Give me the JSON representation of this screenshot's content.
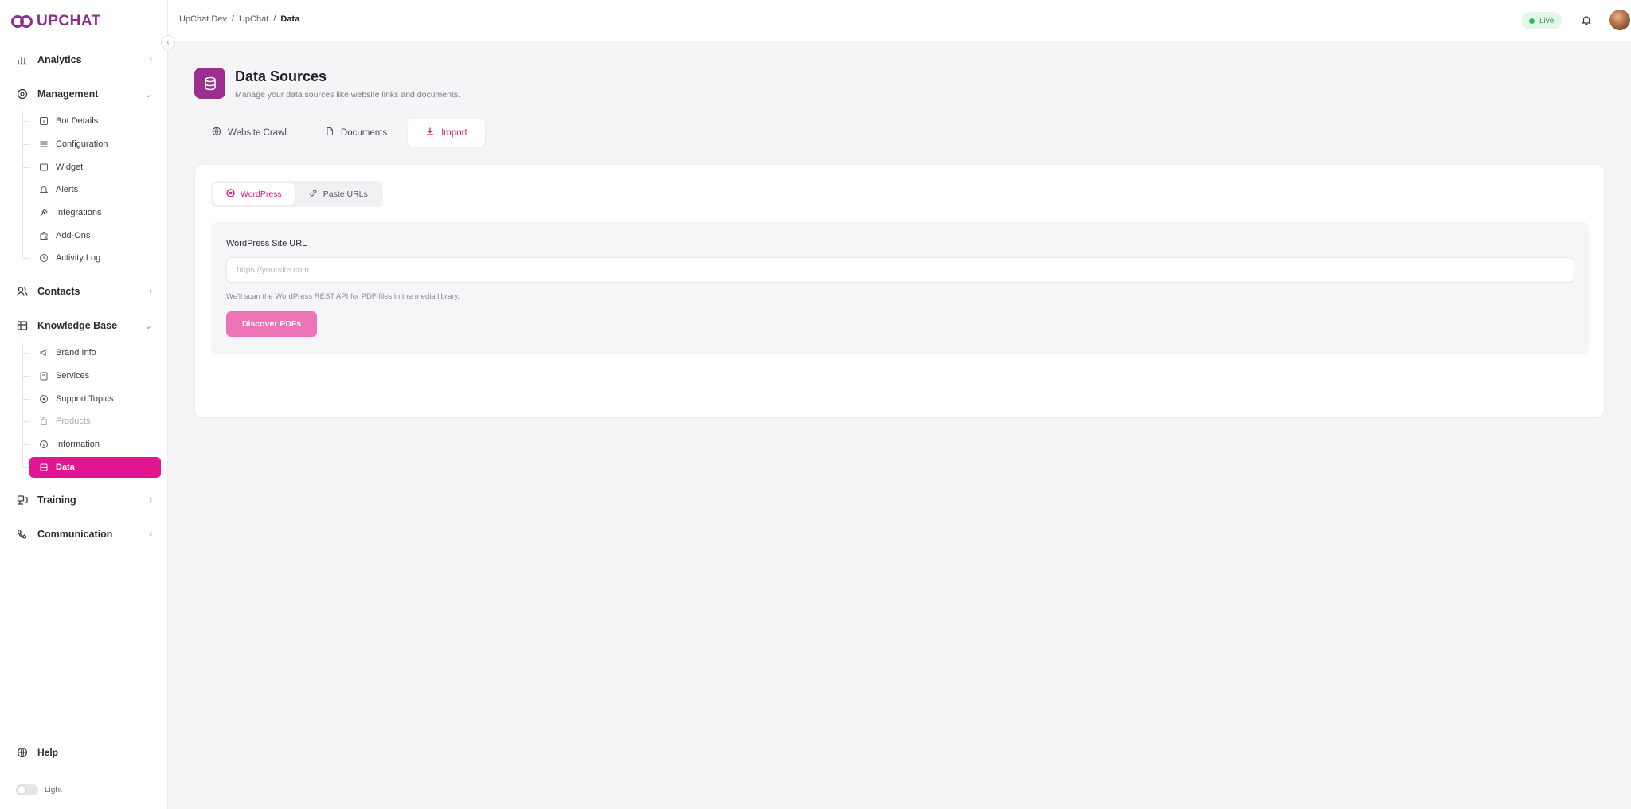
{
  "brand": {
    "name": "UPCHAT"
  },
  "sidebar": {
    "groups": [
      {
        "label": "Analytics"
      },
      {
        "label": "Management"
      },
      {
        "label": "Contacts"
      },
      {
        "label": "Knowledge Base"
      },
      {
        "label": "Training"
      },
      {
        "label": "Communication"
      }
    ],
    "management_items": [
      {
        "label": "Bot Details"
      },
      {
        "label": "Configuration"
      },
      {
        "label": "Widget"
      },
      {
        "label": "Alerts"
      },
      {
        "label": "Integrations"
      },
      {
        "label": "Add-Ons"
      },
      {
        "label": "Activity Log"
      }
    ],
    "knowledge_items": [
      {
        "label": "Brand Info"
      },
      {
        "label": "Services"
      },
      {
        "label": "Support Topics"
      },
      {
        "label": "Products"
      },
      {
        "label": "Information"
      },
      {
        "label": "Data"
      }
    ],
    "help_label": "Help",
    "theme_label": "Light"
  },
  "topbar": {
    "breadcrumb": [
      "UpChat Dev",
      "UpChat",
      "Data"
    ],
    "separator": "/",
    "status": "Live"
  },
  "page": {
    "title": "Data Sources",
    "subtitle": "Manage your data sources like website links and documents."
  },
  "tabs": [
    {
      "label": "Website Crawl"
    },
    {
      "label": "Documents"
    },
    {
      "label": "Import"
    }
  ],
  "import": {
    "segments": [
      {
        "label": "WordPress"
      },
      {
        "label": "Paste URLs"
      }
    ],
    "field_label": "WordPress Site URL",
    "placeholder": "https://yoursite.com",
    "helper": "We'll scan the WordPress REST API for PDF files in the media library.",
    "button_label": "Discover PDFs"
  },
  "colors": {
    "accent": "#e1168f",
    "brand": "#8a2d8f",
    "button": "#ec73b4",
    "live": "#34b760"
  }
}
